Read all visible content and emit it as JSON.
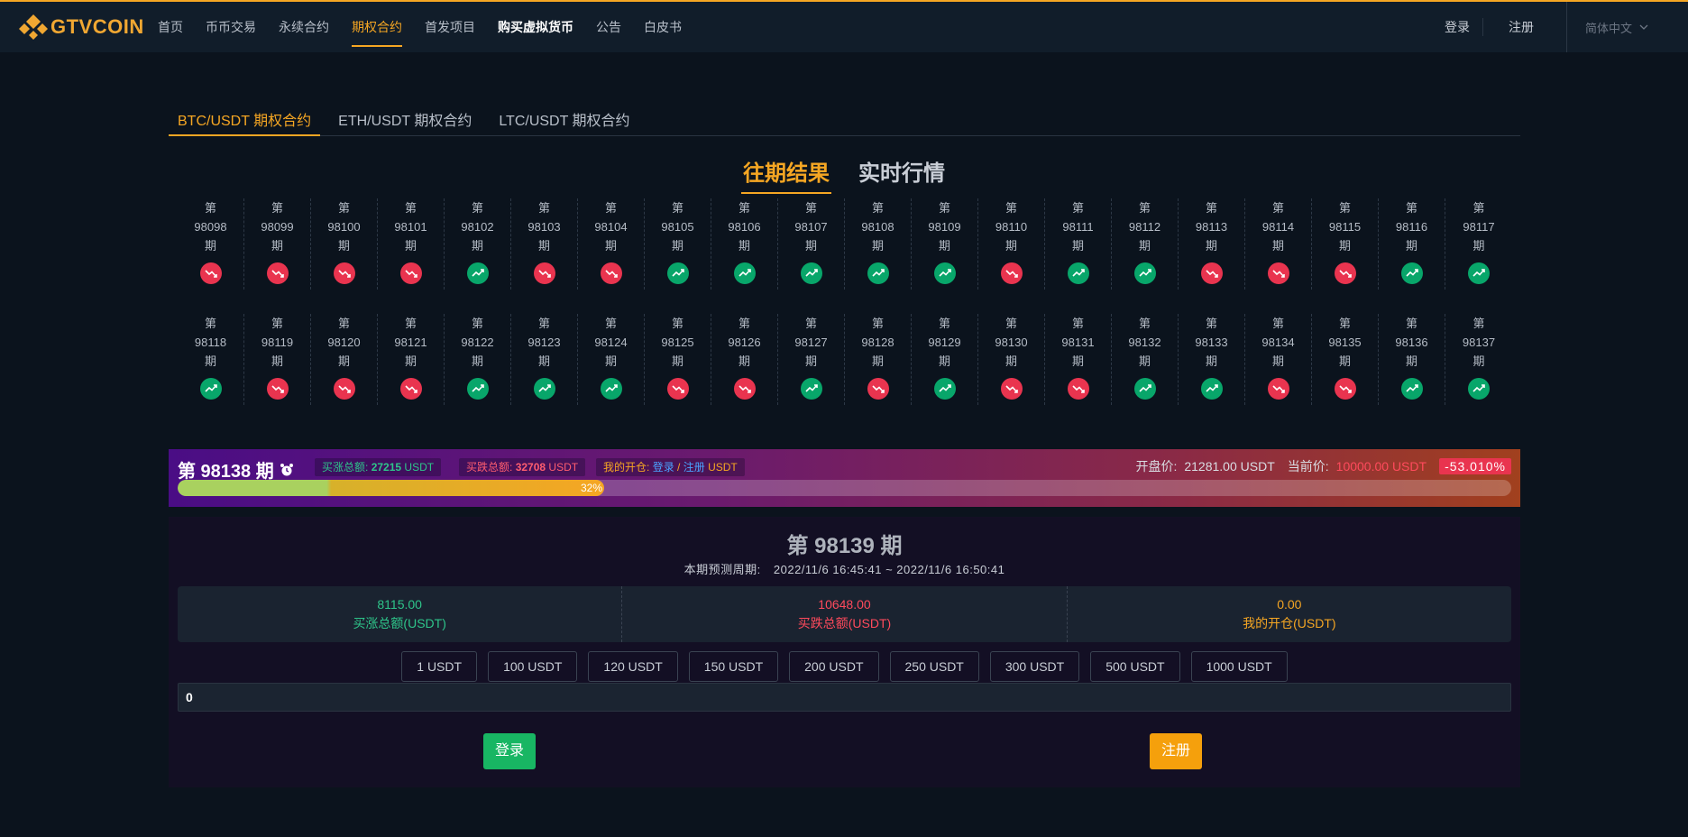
{
  "header": {
    "logo_text": "GTVCOIN",
    "nav": [
      {
        "label": "首页",
        "active": false,
        "bold": false
      },
      {
        "label": "币币交易",
        "active": false,
        "bold": false
      },
      {
        "label": "永续合约",
        "active": false,
        "bold": false
      },
      {
        "label": "期权合约",
        "active": true,
        "bold": false
      },
      {
        "label": "首发项目",
        "active": false,
        "bold": false
      },
      {
        "label": "购买虚拟货币",
        "active": false,
        "bold": true
      },
      {
        "label": "公告",
        "active": false,
        "bold": false
      },
      {
        "label": "白皮书",
        "active": false,
        "bold": false
      }
    ],
    "login": "登录",
    "register": "注册",
    "language": "简体中文"
  },
  "tabs": [
    "BTC/USDT 期权合约",
    "ETH/USDT 期权合约",
    "LTC/USDT 期权合约"
  ],
  "section": {
    "active": "往期结果",
    "inactive": "实时行情"
  },
  "history": {
    "prefix": "第",
    "suffix": "期",
    "rows": [
      [
        {
          "id": "98098",
          "dir": "down"
        },
        {
          "id": "98099",
          "dir": "down"
        },
        {
          "id": "98100",
          "dir": "down"
        },
        {
          "id": "98101",
          "dir": "down"
        },
        {
          "id": "98102",
          "dir": "up"
        },
        {
          "id": "98103",
          "dir": "down"
        },
        {
          "id": "98104",
          "dir": "down"
        },
        {
          "id": "98105",
          "dir": "up"
        },
        {
          "id": "98106",
          "dir": "up"
        },
        {
          "id": "98107",
          "dir": "up"
        },
        {
          "id": "98108",
          "dir": "up"
        },
        {
          "id": "98109",
          "dir": "up"
        },
        {
          "id": "98110",
          "dir": "down"
        },
        {
          "id": "98111",
          "dir": "up"
        },
        {
          "id": "98112",
          "dir": "up"
        },
        {
          "id": "98113",
          "dir": "down"
        },
        {
          "id": "98114",
          "dir": "down"
        },
        {
          "id": "98115",
          "dir": "down"
        },
        {
          "id": "98116",
          "dir": "up"
        },
        {
          "id": "98117",
          "dir": "up"
        }
      ],
      [
        {
          "id": "98118",
          "dir": "up"
        },
        {
          "id": "98119",
          "dir": "down"
        },
        {
          "id": "98120",
          "dir": "down"
        },
        {
          "id": "98121",
          "dir": "down"
        },
        {
          "id": "98122",
          "dir": "up"
        },
        {
          "id": "98123",
          "dir": "up"
        },
        {
          "id": "98124",
          "dir": "up"
        },
        {
          "id": "98125",
          "dir": "down"
        },
        {
          "id": "98126",
          "dir": "down"
        },
        {
          "id": "98127",
          "dir": "up"
        },
        {
          "id": "98128",
          "dir": "down"
        },
        {
          "id": "98129",
          "dir": "up"
        },
        {
          "id": "98130",
          "dir": "down"
        },
        {
          "id": "98131",
          "dir": "down"
        },
        {
          "id": "98132",
          "dir": "up"
        },
        {
          "id": "98133",
          "dir": "up"
        },
        {
          "id": "98134",
          "dir": "down"
        },
        {
          "id": "98135",
          "dir": "down"
        },
        {
          "id": "98136",
          "dir": "up"
        },
        {
          "id": "98137",
          "dir": "up"
        }
      ]
    ]
  },
  "current": {
    "title": "第 98138 期",
    "buy_up_label": "买涨总额:",
    "buy_up_value": "27215",
    "buy_up_unit": "USDT",
    "buy_down_label": "买跌总额:",
    "buy_down_value": "32708",
    "buy_down_unit": "USDT",
    "my_open_label": "我的开仓:",
    "my_open_login": "登录",
    "my_open_sep": "/",
    "my_open_register": "注册",
    "my_open_unit": "USDT",
    "open_price_label": "开盘价:",
    "open_price": "21281.00 USDT",
    "current_price_label": "当前价:",
    "current_price": "10000.00 USDT",
    "change": "-53.010%",
    "progress": 0.32,
    "progress_label": "32%"
  },
  "next": {
    "title": "第 98139 期",
    "cycle_label": "本期预测周期:",
    "cycle_value": "2022/11/6 16:45:41 ~ 2022/11/6 16:50:41"
  },
  "stats": [
    {
      "value": "8115.00",
      "label": "买涨总额(USDT)"
    },
    {
      "value": "10648.00",
      "label": "买跌总额(USDT)"
    },
    {
      "value": "0.00",
      "label": "我的开仓(USDT)"
    }
  ],
  "amounts": [
    "1 USDT",
    "100 USDT",
    "120 USDT",
    "150 USDT",
    "200 USDT",
    "250 USDT",
    "300 USDT",
    "500 USDT",
    "1000 USDT"
  ],
  "amount_input": "0",
  "actions": {
    "login": "登录",
    "register": "注册"
  },
  "colors": {
    "accent": "#f5a623",
    "up": "#08a66a",
    "down": "#e9344f"
  }
}
